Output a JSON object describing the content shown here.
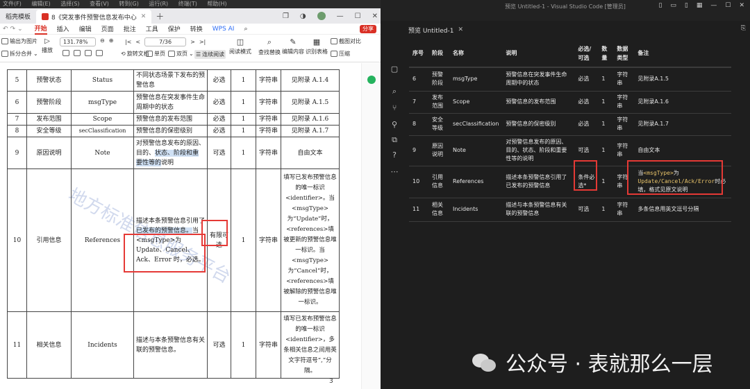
{
  "wps": {
    "menubar": [
      "文件(F)",
      "编辑(E)",
      "选择(S)",
      "查看(V)",
      "转到(G)",
      "运行(R)",
      "终端(T)",
      "帮助(H)"
    ],
    "tabs": {
      "first": "稻壳模板",
      "doc_title": "8《突发事件预警信息发布中心"
    },
    "ribbon_tabs": [
      "开始",
      "插入",
      "编辑",
      "页面",
      "批注",
      "工具",
      "保护",
      "转换"
    ],
    "wps_ai": "WPS AI",
    "share": "分享",
    "toolbar": {
      "export_image": "输出为图片",
      "split_merge": "拆分合并",
      "play": "播放",
      "zoom": "131.78%",
      "page": "7/36",
      "rotate": "旋转文档",
      "single": "单页",
      "double": "双页",
      "continuous": "连续阅读",
      "read_mode": "阅读模式",
      "find_replace": "查找替换",
      "edit_content": "编辑内容",
      "recognize_table": "识别表格",
      "screenshot_compare": "截图对比",
      "compress": "压缩"
    },
    "rows": [
      {
        "no": "5",
        "name": "预警状态",
        "field": "Status",
        "desc": "不同状态场景下发布的预警信息",
        "req": "必选",
        "num": "1",
        "type": "字符串",
        "note": "见附录 A.1.4"
      },
      {
        "no": "6",
        "name": "预警阶段",
        "field": "msgType",
        "desc": "预警信息在突发事件生命周期中的状态",
        "req": "必选",
        "num": "1",
        "type": "字符串",
        "note": "见附录 A.1.5"
      },
      {
        "no": "7",
        "name": "发布范围",
        "field": "Scope",
        "desc": "预警信息的发布范围",
        "req": "必选",
        "num": "1",
        "type": "字符串",
        "note": "见附录 A.1.6"
      },
      {
        "no": "8",
        "name": "安全等级",
        "field": "secClassification",
        "desc": "预警信息的保密级别",
        "req": "必选",
        "num": "1",
        "type": "字符串",
        "note": "见附录 A.1.7"
      },
      {
        "no": "9",
        "name": "原因说明",
        "field": "Note",
        "desc_a": "对预警信息发布的原因、目的、",
        "desc_hl": "状态、阶段和重要性等的",
        "desc_b": "说明",
        "req": "可选",
        "num": "1",
        "type": "字符串",
        "note": "自由文本"
      },
      {
        "no": "10",
        "name": "引用信息",
        "field": "References",
        "desc_a": "描述本条预警信息引用了",
        "desc_hl": "已发布的预警信息。",
        "desc_b": "当<msgType>为Update、Cancel、Ack、Error 时，必选。",
        "req": "有限可选",
        "num": "1",
        "type": "字符串",
        "note": "填写已发布预警信息的唯一标识<identifier>。当<msgType>为“Update”时，<references>填被更新的预警信息唯一标识。当<msgType>为“Cancel”时，<references>填被解除的预警信息唯一标识。"
      },
      {
        "no": "11",
        "name": "相关信息",
        "field": "Incidents",
        "desc": "描述与本条预警信息有关联的预警信息。",
        "req": "可选",
        "num": "1",
        "type": "字符串",
        "note": "填写已发布预警信息的唯一标识<identifier>，多条相关信息之间用英文字符逗号“,”分隔。"
      }
    ],
    "watermark": "地方标准信息服务平台",
    "page_number": "3"
  },
  "vscode": {
    "title": "预览 Untitled-1 - Visual Studio Code [管理员]",
    "tab": "预览 Untitled-1",
    "headers": [
      "序号",
      "阶段",
      "名称",
      "说明",
      "必选/可选",
      "数量",
      "数据类型",
      "备注"
    ],
    "rows": [
      {
        "no": "6",
        "stage": "预警阶段",
        "name": "msgType",
        "desc": "预警信息在突发事件生命周期中的状态",
        "req": "必选",
        "num": "1",
        "type": "字符串",
        "note": "见附录A.1.5"
      },
      {
        "no": "7",
        "stage": "发布范围",
        "name": "Scope",
        "desc": "预警信息的发布范围",
        "req": "必选",
        "num": "1",
        "type": "字符串",
        "note": "见附录A.1.6"
      },
      {
        "no": "8",
        "stage": "安全等级",
        "name": "secClassification",
        "desc": "预警信息的保密级别",
        "req": "必选",
        "num": "1",
        "type": "字符串",
        "note": "见附录A.1.7"
      },
      {
        "no": "9",
        "stage": "原因说明",
        "name": "Note",
        "desc": "对预警信息发布的原因、目的、状态、阶段和重要性等的说明",
        "req": "可选",
        "num": "1",
        "type": "字符串",
        "note": "自由文本"
      },
      {
        "no": "10",
        "stage": "引用信息",
        "name": "References",
        "desc": "描述本条预警信息引用了已发布的预警信息",
        "req": "条件必选*",
        "num": "1",
        "type": "字符串",
        "note_a": "当",
        "note_code1": "<msgType>",
        "note_b": "为",
        "note_code2": "Update/Cancel/Ack/Error",
        "note_c": "时必填，格式见原文说明"
      },
      {
        "no": "11",
        "stage": "相关信息",
        "name": "Incidents",
        "desc": "描述与本条预警信息有关联的预警信息",
        "req": "可选",
        "num": "1",
        "type": "字符串",
        "note": "多条信息用英文逗号分隔"
      }
    ]
  },
  "overlay": {
    "text": "公众号 · 表就那么一层"
  },
  "colors": {
    "accent": "#d93025",
    "highlight_box": "#e53935",
    "code": "#e9c46a"
  }
}
